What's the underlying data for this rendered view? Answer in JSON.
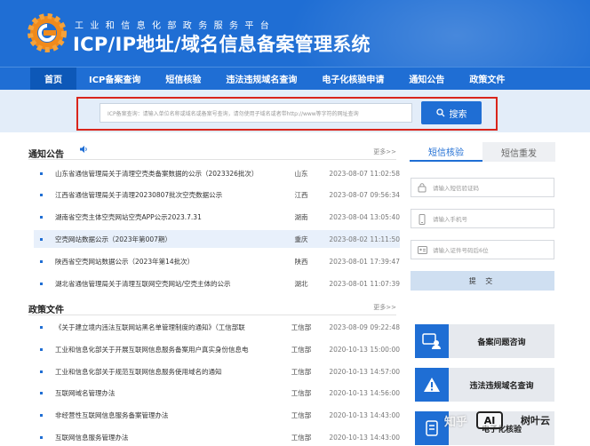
{
  "header": {
    "subtitle": "工业和信息化部政务服务平台",
    "title": "ICP/IP地址/域名信息备案管理系统"
  },
  "nav": [
    "首页",
    "ICP备案查询",
    "短信核验",
    "违法违规域名查询",
    "电子化核验申请",
    "通知公告",
    "政策文件"
  ],
  "search": {
    "placeholder": "ICP备案查询：请输入单位名称或域名或备案号查询，请勿使用子域名或者带http://www等字符的网址查询",
    "button_label": "搜索"
  },
  "notices": {
    "title": "通知公告",
    "more": "更多>>",
    "rows": [
      {
        "title": "山东省通信管理局关于清理空壳类备案数据的公示（2023326批次）",
        "region": "山东",
        "date": "2023-08-07 11:02:58"
      },
      {
        "title": "江西省通信管理局关于清理20230807批次空壳数据公示",
        "region": "江西",
        "date": "2023-08-07 09:56:34"
      },
      {
        "title": "湖南省空壳主体空壳网站空壳APP公示2023.7.31",
        "region": "湖南",
        "date": "2023-08-04 13:05:40"
      },
      {
        "title": "空壳网站数据公示（2023年第007期）",
        "region": "重庆",
        "date": "2023-08-02 11:11:50"
      },
      {
        "title": "陕西省空壳网站数据公示（2023年第14批次）",
        "region": "陕西",
        "date": "2023-08-01 17:39:47"
      },
      {
        "title": "湖北省通信管理局关于清理互联网空壳网站/空壳主体的公示",
        "region": "湖北",
        "date": "2023-08-01 11:07:39"
      }
    ]
  },
  "policies": {
    "title": "政策文件",
    "more": "更多>>",
    "rows": [
      {
        "title": "《关于建立境内违法互联网站黑名单管理制度的通知》（工信部联",
        "region": "工信部",
        "date": "2023-08-09 09:22:48"
      },
      {
        "title": "工业和信息化部关于开展互联网信息服务备案用户真实身份信息电",
        "region": "工信部",
        "date": "2020-10-13 15:00:00"
      },
      {
        "title": "工业和信息化部关于规范互联网信息服务使用域名的通知",
        "region": "工信部",
        "date": "2020-10-13 14:57:00"
      },
      {
        "title": "互联网域名管理办法",
        "region": "工信部",
        "date": "2020-10-13 14:56:00"
      },
      {
        "title": "非经营性互联网信息服务备案管理办法",
        "region": "工信部",
        "date": "2020-10-13 14:43:00"
      },
      {
        "title": "互联网信息服务管理办法",
        "region": "工信部",
        "date": "2020-10-13 14:43:00"
      }
    ]
  },
  "sms": {
    "tab_active": "短信核验",
    "tab_inactive": "短信重发",
    "code_placeholder": "请输入短信验证码",
    "phone_placeholder": "请输入手机号",
    "id_placeholder": "请输入证件号码后6位",
    "submit_label": "提 交"
  },
  "cards": [
    {
      "label": "备案问题咨询",
      "icon": "consult-icon"
    },
    {
      "label": "违法违规域名查询",
      "icon": "warning-icon"
    },
    {
      "label": "电子化核验",
      "icon": "verify-icon"
    }
  ],
  "watermark": {
    "site": "知乎",
    "ai": "AI",
    "tree": "树叶云"
  },
  "colors": {
    "brand_blue": "#1f6ed4",
    "nav_active": "#0d58b8",
    "highlight_red": "#d9251c"
  }
}
